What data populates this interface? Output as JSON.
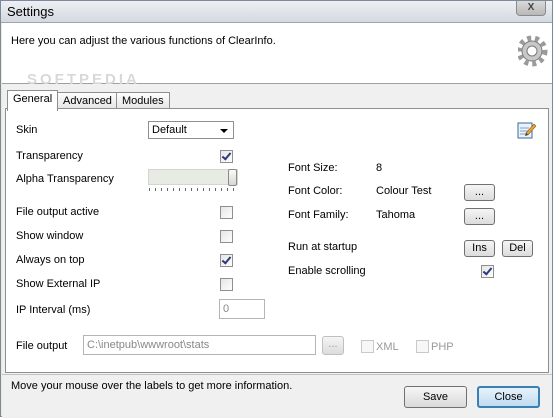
{
  "window": {
    "title": "Settings",
    "close_glyph": "X"
  },
  "header": {
    "description": "Here you can adjust the various functions of ClearInfo.",
    "watermark": "SOFTPEDIA"
  },
  "tabs": [
    {
      "label": "General"
    },
    {
      "label": "Advanced"
    },
    {
      "label": "Modules"
    }
  ],
  "general": {
    "skin": {
      "label": "Skin",
      "value": "Default"
    },
    "transparency": {
      "label": "Transparency",
      "checked": true
    },
    "alpha": {
      "label": "Alpha Transparency",
      "level": 1.0
    },
    "file_output_active": {
      "label": "File output active",
      "checked": false
    },
    "show_window": {
      "label": "Show window",
      "checked": false
    },
    "always_on_top": {
      "label": "Always on top",
      "checked": true
    },
    "show_external_ip": {
      "label": "Show External IP",
      "checked": false
    },
    "ip_interval": {
      "label": "IP Interval (ms)",
      "value": "0"
    },
    "font_size": {
      "label": "Font Size:",
      "value": "8"
    },
    "font_color": {
      "label": "Font Color:",
      "value": "Colour Test",
      "button": "..."
    },
    "font_family": {
      "label": "Font Family:",
      "value": "Tahoma",
      "button": "..."
    },
    "run_at_startup": {
      "label": "Run at startup",
      "ins": "Ins",
      "del": "Del"
    },
    "enable_scrolling": {
      "label": "Enable scrolling",
      "checked": true
    },
    "file_output": {
      "label": "File output",
      "path": "C:\\inetpub\\wwwroot\\stats",
      "browse": "...",
      "xml": "XML",
      "php": "PHP"
    }
  },
  "footer": {
    "hint": "Move your mouse over the labels to get more information.",
    "save": "Save",
    "close": "Close"
  },
  "icons": {
    "gear": "gear-icon",
    "edit": "edit-notepad-icon"
  },
  "colors": {
    "accent": "#3c7fb1",
    "check": "#2a3a7a"
  }
}
